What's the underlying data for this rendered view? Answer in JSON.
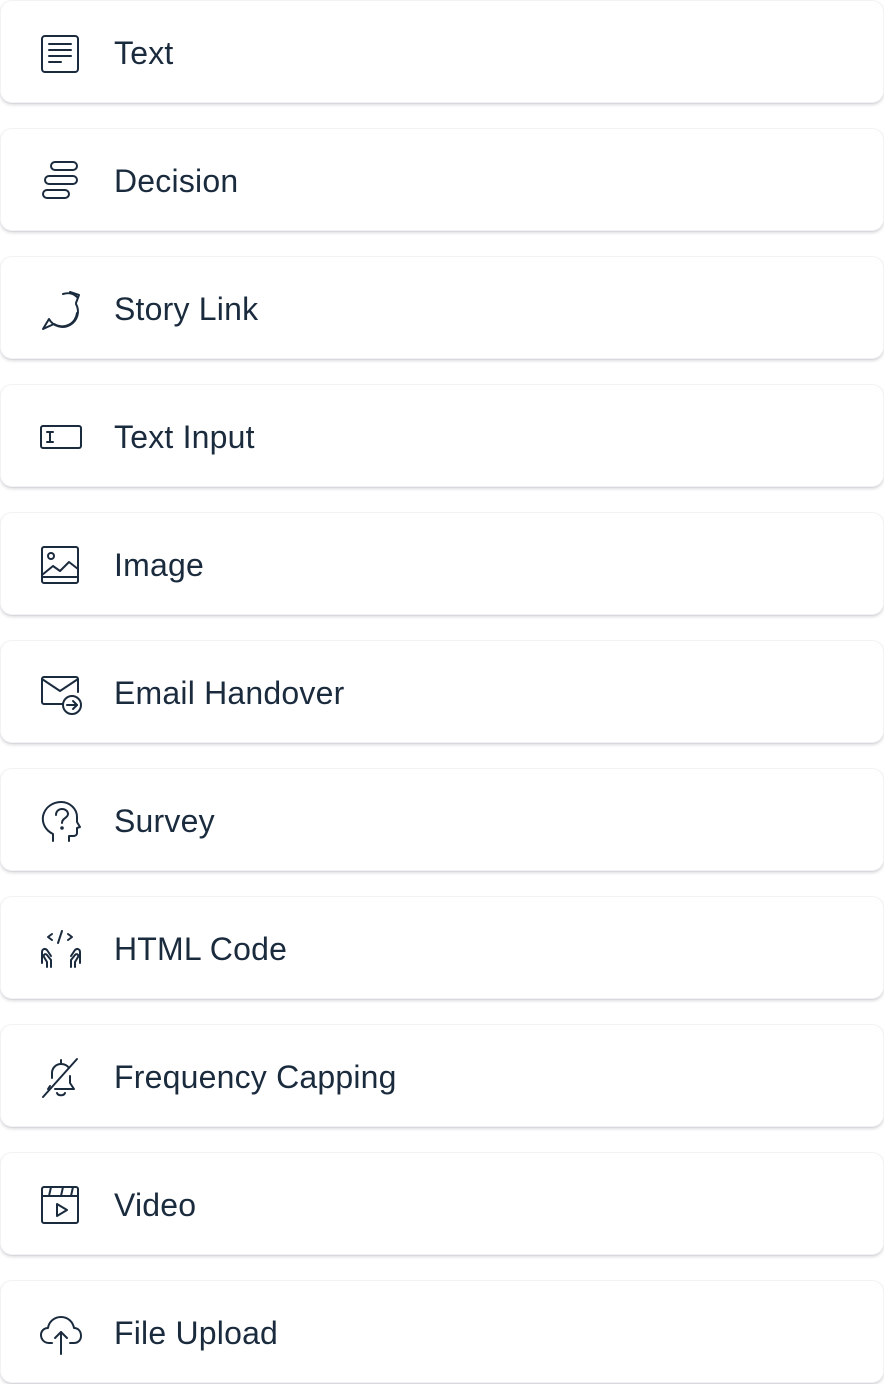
{
  "items": [
    {
      "label": "Text",
      "icon": "text-document-icon"
    },
    {
      "label": "Decision",
      "icon": "decision-bars-icon"
    },
    {
      "label": "Story Link",
      "icon": "story-link-icon"
    },
    {
      "label": "Text Input",
      "icon": "text-input-icon"
    },
    {
      "label": "Image",
      "icon": "image-icon"
    },
    {
      "label": "Email Handover",
      "icon": "email-handover-icon"
    },
    {
      "label": "Survey",
      "icon": "survey-question-icon"
    },
    {
      "label": "HTML Code",
      "icon": "html-code-icon"
    },
    {
      "label": "Frequency Capping",
      "icon": "bell-off-icon"
    },
    {
      "label": "Video",
      "icon": "video-icon"
    },
    {
      "label": "File Upload",
      "icon": "cloud-upload-icon"
    }
  ],
  "colors": {
    "text": "#1b2b3e",
    "card_background": "#ffffff",
    "card_border": "#f1f3f5"
  }
}
